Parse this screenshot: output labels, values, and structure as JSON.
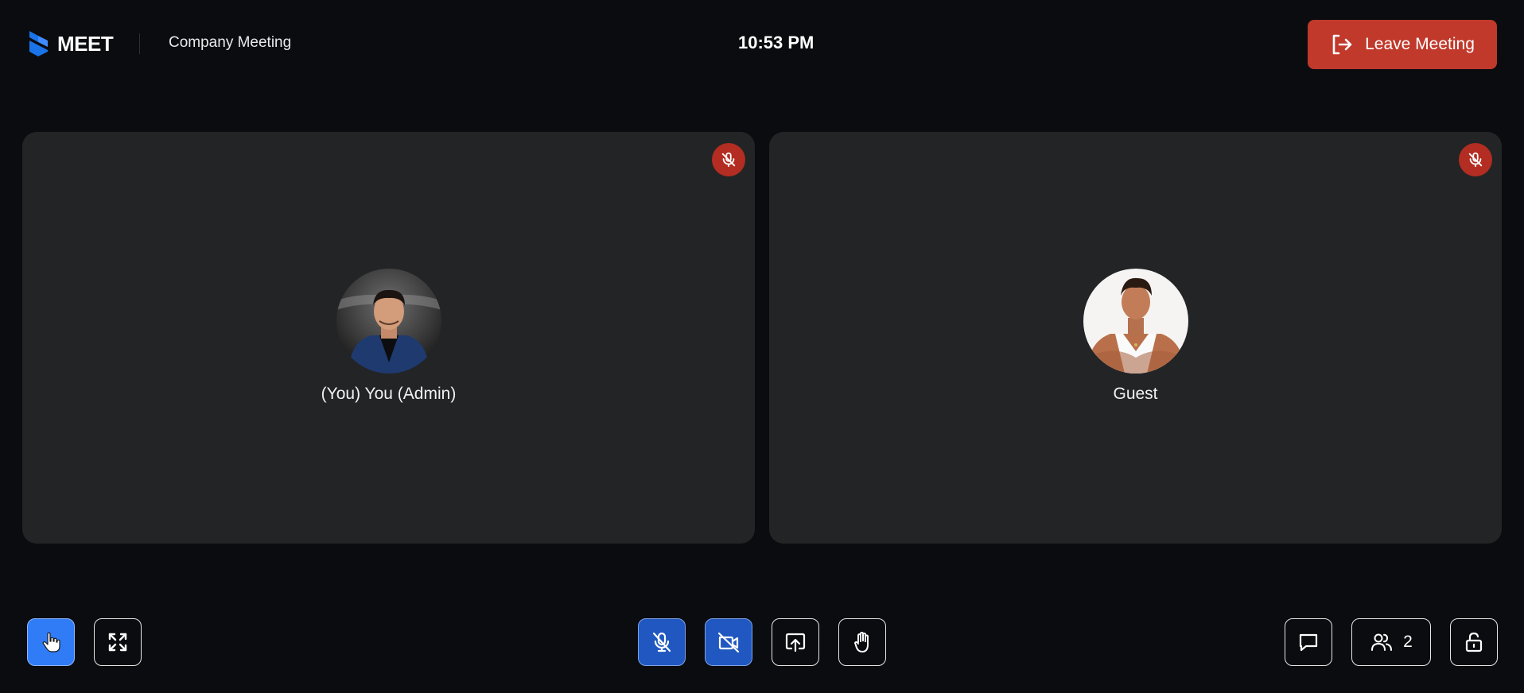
{
  "header": {
    "logo_text": "MEET",
    "meeting_title": "Company Meeting",
    "clock": "10:53 PM",
    "leave_label": "Leave Meeting"
  },
  "participants": [
    {
      "name": "(You) You (Admin)",
      "muted": true,
      "avatar": "man-in-denim-jacket-photo"
    },
    {
      "name": "Guest",
      "muted": true,
      "avatar": "man-in-white-tank-top-photo"
    }
  ],
  "toolbar": {
    "left": [
      {
        "icon": "pointer-hand-icon",
        "active": true
      },
      {
        "icon": "fullscreen-icon",
        "active": false
      }
    ],
    "center": [
      {
        "icon": "mic-off-icon",
        "active": true
      },
      {
        "icon": "camera-off-icon",
        "active": true
      },
      {
        "icon": "screen-share-icon",
        "active": false
      },
      {
        "icon": "raise-hand-icon",
        "active": false
      }
    ],
    "right": [
      {
        "icon": "chat-icon"
      },
      {
        "icon": "participants-icon",
        "count": "2"
      },
      {
        "icon": "unlock-icon"
      }
    ]
  },
  "colors": {
    "background": "#0b0c0f",
    "tile": "#232426",
    "leave_button": "#c0392b",
    "mute_badge": "#b32d22",
    "active_blue": "#2057c0",
    "pointer_blue": "#2f7cf6",
    "brand": "#1a73e8"
  }
}
